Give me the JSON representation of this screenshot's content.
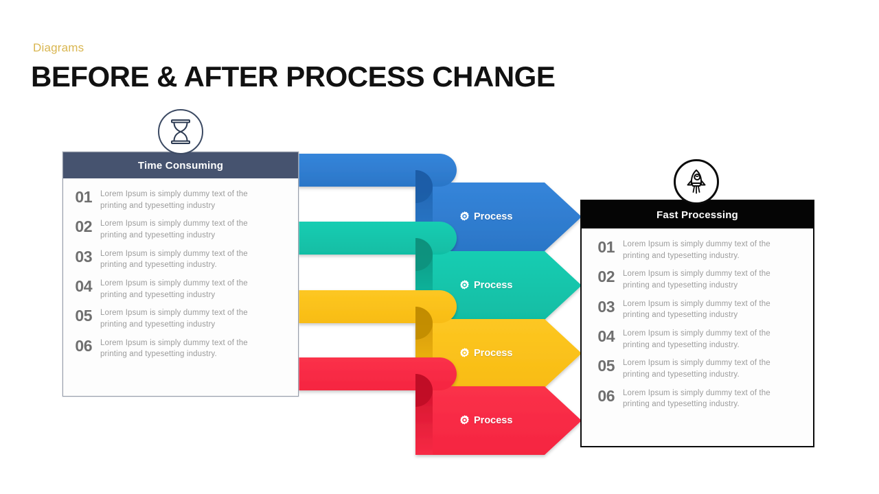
{
  "header": {
    "kicker": "Diagrams",
    "title": "BEFORE & AFTER PROCESS CHANGE",
    "kicker_color": "#d9b650",
    "title_color": "#111111"
  },
  "left_panel": {
    "heading": "Time Consuming",
    "heading_bg": "#46536f",
    "icon": "hourglass-icon",
    "items": [
      {
        "number": "01",
        "text": "Lorem Ipsum is simply dummy text of the printing and typesetting industry"
      },
      {
        "number": "02",
        "text": "Lorem Ipsum is simply dummy text of the printing and typesetting industry"
      },
      {
        "number": "03",
        "text": "Lorem Ipsum is simply dummy text of the printing and typesetting industry."
      },
      {
        "number": "04",
        "text": "Lorem Ipsum is simply dummy text of the printing and typesetting industry"
      },
      {
        "number": "05",
        "text": "Lorem Ipsum is simply dummy text of the printing and typesetting industry"
      },
      {
        "number": "06",
        "text": "Lorem Ipsum is simply dummy text of the printing and typesetting industry."
      }
    ]
  },
  "right_panel": {
    "heading": "Fast Processing",
    "heading_bg": "#050505",
    "icon": "rocket-icon",
    "items": [
      {
        "number": "01",
        "text": "Lorem Ipsum is simply dummy text of the printing and typesetting industry."
      },
      {
        "number": "02",
        "text": "Lorem Ipsum is simply dummy text of the printing and typesetting industry"
      },
      {
        "number": "03",
        "text": "Lorem Ipsum is simply dummy text of the printing and typesetting industry"
      },
      {
        "number": "04",
        "text": "Lorem Ipsum is simply dummy text of the printing and typesetting industry."
      },
      {
        "number": "05",
        "text": "Lorem Ipsum is simply dummy text of the printing and typesetting industry."
      },
      {
        "number": "06",
        "text": "Lorem Ipsum is simply dummy text of the printing and typesetting industry."
      }
    ]
  },
  "ribbons": [
    {
      "label": "Process",
      "icon": "gear-icon",
      "color": "#3080d4",
      "fold_color": "#1f66b4",
      "shadow_color": "#1a5ca6"
    },
    {
      "label": "Process",
      "icon": "gear-icon",
      "color": "#16c6ac",
      "fold_color": "#0a9e89",
      "shadow_color": "#08907c"
    },
    {
      "label": "Process",
      "icon": "gear-icon",
      "color": "#fbc21c",
      "fold_color": "#d69b00",
      "shadow_color": "#c08b00"
    },
    {
      "label": "Process",
      "icon": "gear-icon",
      "color": "#f92c46",
      "fold_color": "#d4112c",
      "shadow_color": "#bd0e26"
    }
  ]
}
